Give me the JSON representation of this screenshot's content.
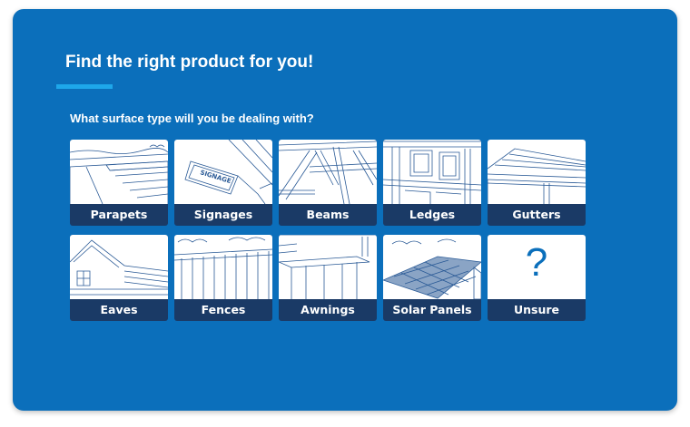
{
  "header": {
    "title": "Find the right product for you!",
    "question": "What surface type will you be dealing with?"
  },
  "colors": {
    "panel": "#0b6fbb",
    "accent": "#1ea7ea",
    "label_bar": "#1a3a66",
    "illustration_line": "#2a5a96"
  },
  "options": [
    {
      "label": "Parapets",
      "icon": "parapet-illustration"
    },
    {
      "label": "Signages",
      "icon": "signage-illustration",
      "sign_text": "SIGNAGE"
    },
    {
      "label": "Beams",
      "icon": "beam-illustration"
    },
    {
      "label": "Ledges",
      "icon": "ledge-illustration"
    },
    {
      "label": "Gutters",
      "icon": "gutter-illustration"
    },
    {
      "label": "Eaves",
      "icon": "eave-illustration"
    },
    {
      "label": "Fences",
      "icon": "fence-illustration"
    },
    {
      "label": "Awnings",
      "icon": "awning-illustration"
    },
    {
      "label": "Solar Panels",
      "icon": "solar-panel-illustration"
    },
    {
      "label": "Unsure",
      "icon": "question-mark-icon",
      "glyph": "?"
    }
  ]
}
